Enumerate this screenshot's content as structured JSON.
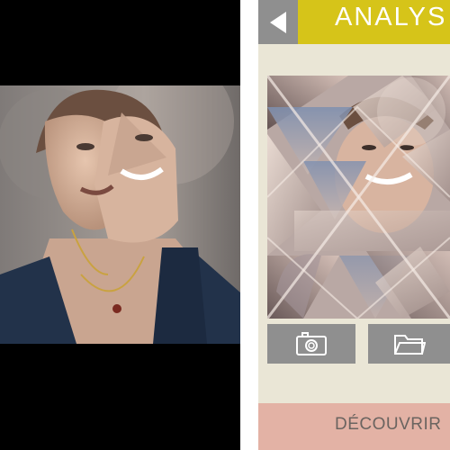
{
  "left_panel": {
    "photo_description_icon": "fragmented-portrait-photo"
  },
  "header": {
    "title": "ANALYS",
    "back_icon": "back-arrow-icon"
  },
  "actions": {
    "camera_icon": "camera-icon",
    "folder_icon": "folder-icon"
  },
  "footer": {
    "discover_label": "DÉCOUVRIR"
  },
  "colors": {
    "accent_yellow": "#d6c419",
    "button_gray": "#8f8f8f",
    "panel_beige": "#eae6d6",
    "discover_pink": "#e3b2a5"
  }
}
